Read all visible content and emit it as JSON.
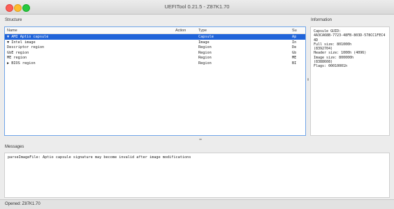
{
  "window": {
    "title": "UEFITool 0.21.5 - Z87K1.70"
  },
  "structure": {
    "label": "Structure",
    "columns": {
      "name": "Name",
      "action": "Action",
      "type": "Type",
      "subtype": "Su"
    },
    "rows": [
      {
        "name": "▼ AMI Aptio capsule",
        "action": "",
        "type": "Capsule",
        "subtype": "Ap",
        "selected": true
      },
      {
        "name": "  ▼ Intel image",
        "action": "",
        "type": "Image",
        "subtype": "In",
        "selected": false
      },
      {
        "name": "      Descriptor region",
        "action": "",
        "type": "Region",
        "subtype": "De",
        "selected": false
      },
      {
        "name": "      GbE region",
        "action": "",
        "type": "Region",
        "subtype": "Gb",
        "selected": false
      },
      {
        "name": "      ME region",
        "action": "",
        "type": "Region",
        "subtype": "ME",
        "selected": false
      },
      {
        "name": "    ▶ BIOS region",
        "action": "",
        "type": "Region",
        "subtype": "BI",
        "selected": false
      }
    ]
  },
  "information": {
    "label": "Information",
    "lines": [
      "Capsule GUID:",
      "4A3CA68B-7723-48FB-803D-578CC1FEC44D",
      "Full size: 801000h",
      "(8392704)",
      "Header size: 1000h (4096)",
      "Image size: 800000h",
      "(8388608)",
      "Flags: 00010001h"
    ]
  },
  "messages": {
    "label": "Messages",
    "items": [
      "parseImageFile: Aptio capsule signature may become invalid after image modifications"
    ]
  },
  "status": {
    "text": "Opened: Z87K1.70"
  },
  "colors": {
    "selection": "#1f63d9",
    "focus_border": "#6fa4e8"
  }
}
